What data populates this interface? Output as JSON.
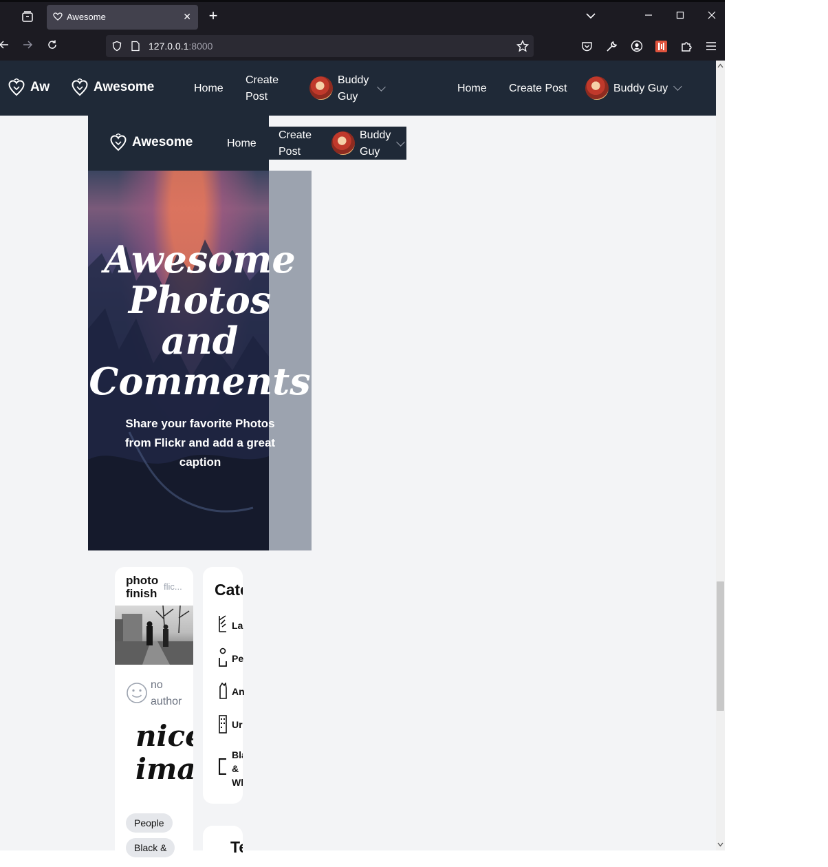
{
  "browser": {
    "tab_title": "Awesome",
    "url_host": "127.0.0.1",
    "url_port": ":8000"
  },
  "nav": {
    "brand": "Awesome",
    "brand_truncated": "Aw",
    "home": "Home",
    "create_post": "Create Post",
    "create_post_line1": "Create",
    "create_post_line2": "Post",
    "user_name": "Buddy Guy",
    "user_line1": "Buddy",
    "user_line2": "Guy"
  },
  "hero": {
    "title_lines": [
      "Awesome",
      "Photos",
      "and",
      "Comments"
    ],
    "subtitle": "Share your favorite Photos from Flickr and add a great caption"
  },
  "post_card": {
    "title": "photo finish",
    "source": "flic...",
    "author": "no author",
    "caption": "nice imag",
    "tags": [
      "People",
      "Black &"
    ]
  },
  "categories": {
    "heading": "Cate",
    "items": [
      "La",
      "Pe",
      "An",
      "Ur",
      "Bla & Wl"
    ]
  },
  "next_card": {
    "heading": "Te"
  }
}
